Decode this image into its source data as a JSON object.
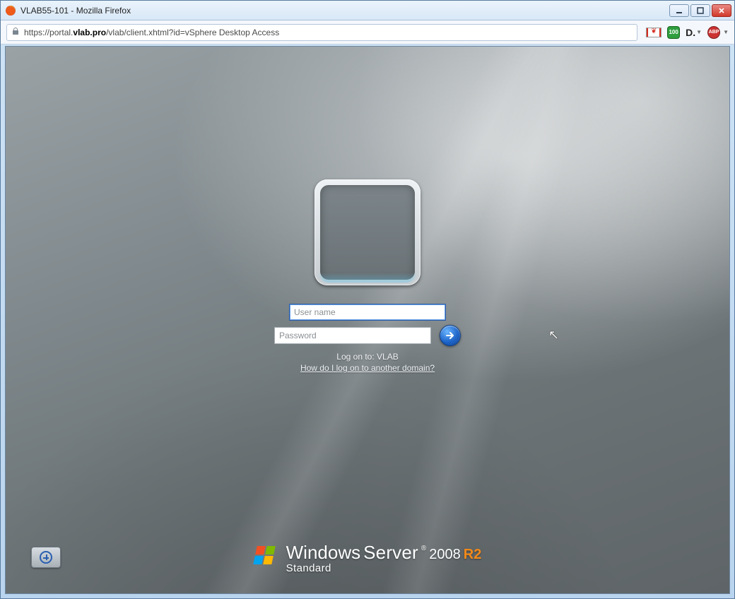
{
  "window": {
    "title": "VLAB55-101 - Mozilla Firefox"
  },
  "address": {
    "scheme": "https://",
    "host_pre": "portal.",
    "host_bold": "vlab.pro",
    "path": "/vlab/client.xhtml?id=vSphere Desktop Access"
  },
  "toolbar": {
    "shield_text": "100",
    "d_label": "D.",
    "abp_text": "ABP"
  },
  "login": {
    "username_placeholder": "User name",
    "password_placeholder": "Password",
    "logon_to_label": "Log on to: ",
    "logon_domain": "VLAB",
    "other_domain_link": "How do I log on to another domain?"
  },
  "branding": {
    "windows": "Windows",
    "server": "Server",
    "reg": "®",
    "year": "2008",
    "r2": "R2",
    "edition": "Standard"
  }
}
